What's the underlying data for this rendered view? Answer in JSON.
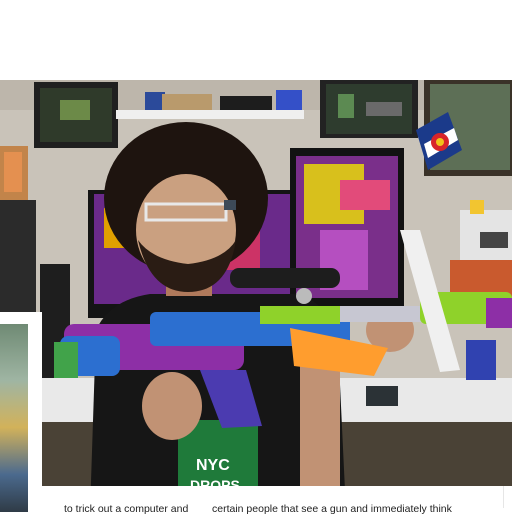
{
  "photo": {
    "subject": "person-holding-toy-blaster",
    "shirt_text": "NYC DROPS",
    "accent_colors": {
      "blaster_purple": "#8d2fa6",
      "blaster_blue": "#2c6fd0",
      "blaster_green": "#8fd22a",
      "blaster_orange": "#ff9d2e",
      "flag_red": "#d8242a",
      "flag_blue": "#1b3a8a"
    }
  },
  "caption": {
    "left": "to trick out a computer and",
    "right": "certain people that see a gun and immediately think"
  }
}
